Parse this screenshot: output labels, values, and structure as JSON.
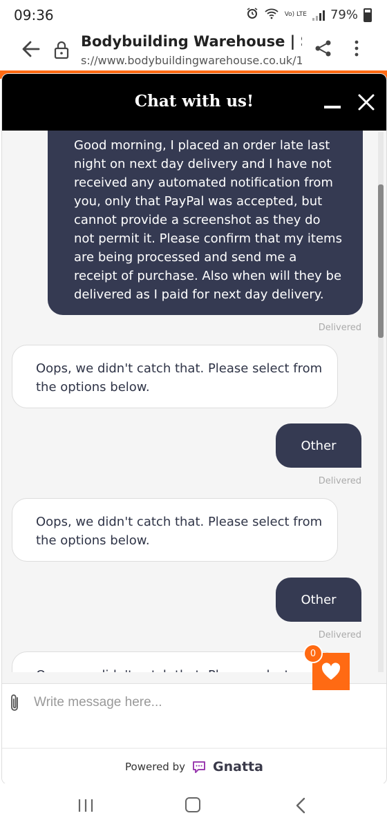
{
  "status_bar": {
    "time": "09:36",
    "battery": "79%",
    "network": "Vo) LTE"
  },
  "browser": {
    "page_title": "Bodybuilding Warehouse | Spo...",
    "url": "s://www.bodybuildingwarehouse.co.uk/1"
  },
  "chat": {
    "title": "Chat with us!",
    "messages": [
      {
        "from": "user",
        "text": "Good morning, I placed an order late last night on next day delivery and I have not received any automated notification from you, only that PayPal was accepted, but cannot provide a screenshot as they do not permit it. Please confirm that my items are being processed and send me a receipt of purchase. Also when will they be delivered as I paid for next day delivery.",
        "status": "Delivered"
      },
      {
        "from": "bot",
        "text": "Oops, we didn't catch that. Please select from the options below."
      },
      {
        "from": "user",
        "text": "Other",
        "status": "Delivered"
      },
      {
        "from": "bot",
        "text": "Oops, we didn't catch that. Please select from the options below."
      },
      {
        "from": "user",
        "text": "Other",
        "status": "Delivered"
      },
      {
        "from": "bot",
        "text": "Oops, we didn't catch that. Please select"
      }
    ],
    "input_placeholder": "Write message here...",
    "footer_prefix": "Powered by",
    "footer_brand": "Gnatta"
  },
  "wishlist": {
    "count": "0"
  },
  "colors": {
    "accent": "#ff6a13",
    "user_bubble": "#353a52",
    "header": "#000000"
  }
}
